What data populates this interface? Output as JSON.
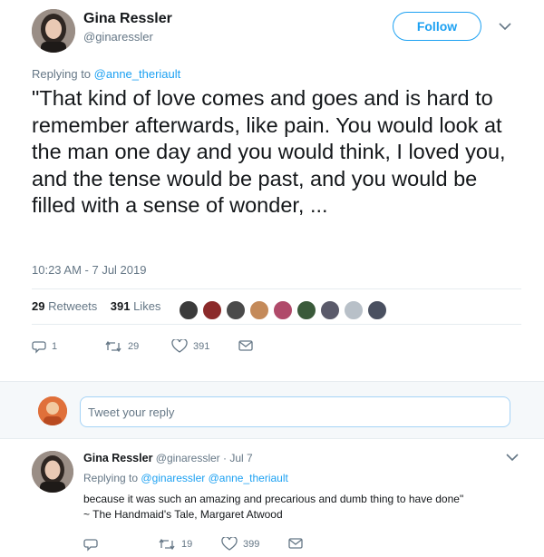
{
  "tweet": {
    "author_name": "Gina Ressler",
    "author_handle": "@ginaressler",
    "follow_label": "Follow",
    "replying_prefix": "Replying to",
    "replying_handle": "@anne_theriault",
    "text": "\"That kind of love comes and goes and is hard to remember afterwards, like pain. You would look at the man one day and you would think, I loved you, and the tense would be past, and you would be filled with a sense of wonder, ...",
    "timestamp": "10:23 AM - 7 Jul 2019",
    "retweets_count": "29",
    "retweets_label": "Retweets",
    "likes_count": "391",
    "likes_label": "Likes",
    "actions": {
      "replies": "1",
      "retweets": "29",
      "likes": "391"
    }
  },
  "likers": [
    {
      "icon": "avatar-icon",
      "color": "#3b3b3b"
    },
    {
      "icon": "avatar-icon",
      "color": "#8b2a2a"
    },
    {
      "icon": "avatar-icon",
      "color": "#4a4a4a"
    },
    {
      "icon": "avatar-icon",
      "color": "#c48a5a"
    },
    {
      "icon": "avatar-icon",
      "color": "#b04a6a"
    },
    {
      "icon": "avatar-icon",
      "color": "#3a5a3a"
    },
    {
      "icon": "avatar-icon",
      "color": "#5a5a6a"
    },
    {
      "icon": "avatar-icon",
      "color": "#b8c0c8"
    },
    {
      "icon": "avatar-icon",
      "color": "#4a5060"
    }
  ],
  "reply_box": {
    "placeholder": "Tweet your reply"
  },
  "reply": {
    "author_name": "Gina Ressler",
    "author_handle": "@ginaressler",
    "separator": "·",
    "date": "Jul 7",
    "replying_prefix": "Replying to",
    "replying_handles": "@ginaressler @anne_theriault",
    "text_line1": "because it was such an amazing and precarious and dumb thing to have done\"",
    "text_line2": "~ The Handmaid's Tale, Margaret Atwood",
    "actions": {
      "retweets": "19",
      "likes": "399"
    }
  },
  "colors": {
    "accent": "#1da1f2",
    "text": "#14171a",
    "secondary": "#657786",
    "divider": "#e6ecf0",
    "band": "#f5f8fa"
  }
}
